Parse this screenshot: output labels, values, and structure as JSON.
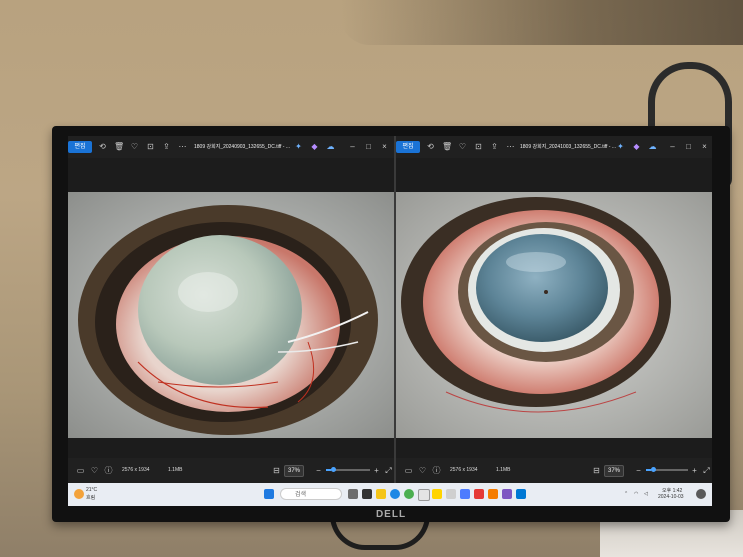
{
  "monitor": {
    "brand": "DELL"
  },
  "panes": [
    {
      "edit_label": "편집",
      "file_title": "1809 강희지_20240903_132655_DC.tiff - ...",
      "dimensions": "2576 x 1934",
      "file_size": "1.1MB",
      "zoom": "37%",
      "zoom_level": 0.12
    },
    {
      "edit_label": "편집",
      "file_title": "1809 강희지_20241003_132655_DC.tiff - ...",
      "dimensions": "2576 x 1934",
      "file_size": "1.1MB",
      "zoom": "37%",
      "zoom_level": 0.12
    }
  ],
  "taskbar": {
    "weather_temp": "21°C",
    "weather_desc": "흐림",
    "search_placeholder": "검색",
    "time": "오후 1:42",
    "date": "2024-10-03"
  },
  "colors": {
    "edit_button": "#1a73d6",
    "slider_accent": "#4aa3ff",
    "taskbar": "#e9edf3"
  }
}
